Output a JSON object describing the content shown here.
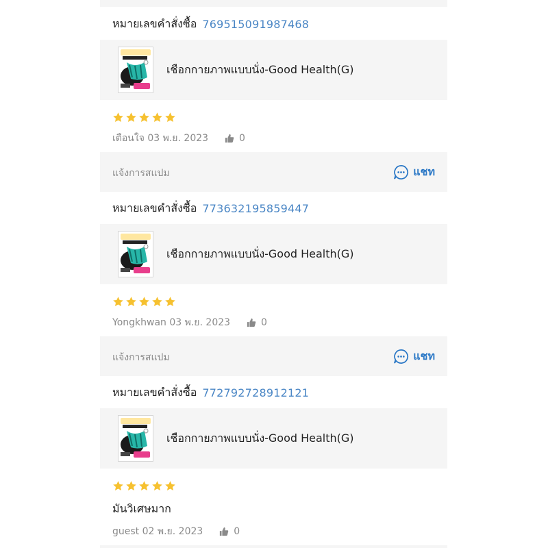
{
  "reviews": [
    {
      "order_label": "หมายเลขคำสั่งซื้อ",
      "order_number": "769515091987468",
      "product_name": "เชือกกายภาพแบบนั่ง-Good Health(G)",
      "rating": 5,
      "comment": "",
      "reviewer": "เตือนใจ",
      "date": "03 พ.ย. 2023",
      "likes": "0",
      "spam_label": "แจ้งการสแปม",
      "chat_label": "แชท"
    },
    {
      "order_label": "หมายเลขคำสั่งซื้อ",
      "order_number": "773632195859447",
      "product_name": "เชือกกายภาพแบบนั่ง-Good Health(G)",
      "rating": 5,
      "comment": "",
      "reviewer": "Yongkhwan",
      "date": "03 พ.ย. 2023",
      "likes": "0",
      "spam_label": "แจ้งการสแปม",
      "chat_label": "แชท"
    },
    {
      "order_label": "หมายเลขคำสั่งซื้อ",
      "order_number": "772792728912121",
      "product_name": "เชือกกายภาพแบบนั่ง-Good Health(G)",
      "rating": 5,
      "comment": "มันวิเศษมาก",
      "reviewer": "guest",
      "date": "02 พ.ย. 2023",
      "likes": "0"
    }
  ],
  "icons": {
    "star": "star-icon",
    "like": "thumbs-up-icon",
    "chat": "chat-bubble-icon",
    "thumbnail": "product-thumbnail"
  },
  "colors": {
    "star": "#f6c130",
    "order_number": "#4a86c5",
    "chat": "#2b78c6",
    "muted_text": "#8a8a8a",
    "panel": "#f5f5f5"
  }
}
